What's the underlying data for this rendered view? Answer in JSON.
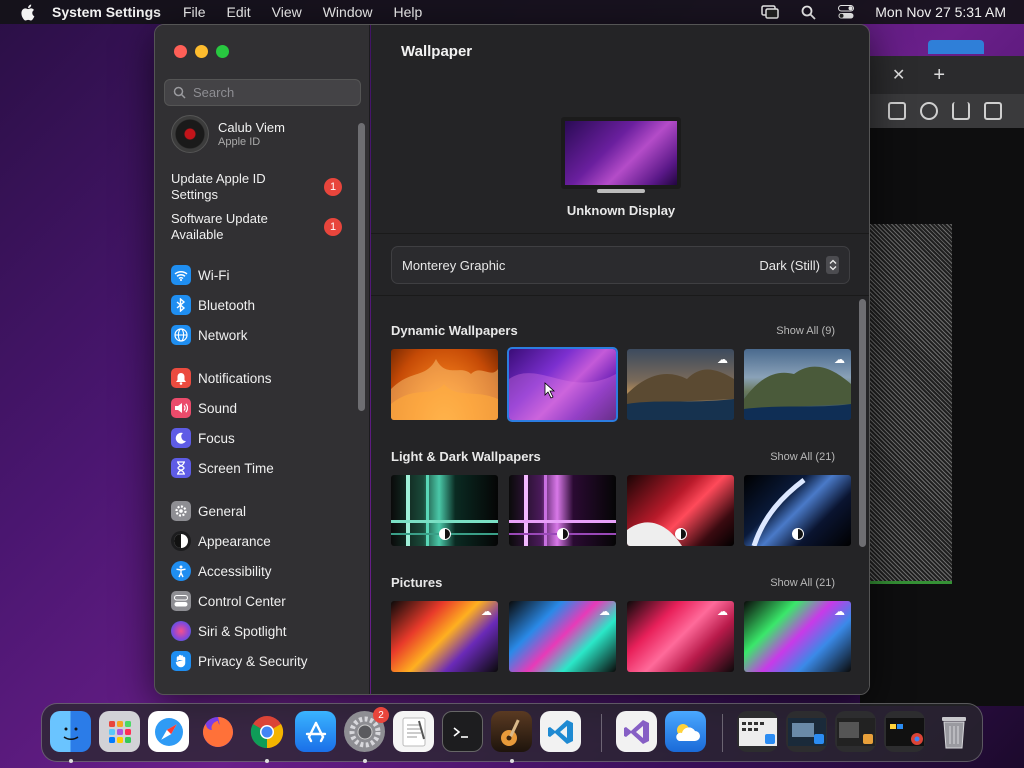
{
  "menubar": {
    "app_name": "System Settings",
    "items": [
      "File",
      "Edit",
      "View",
      "Window",
      "Help"
    ],
    "clock": "Mon Nov 27  5:31 AM"
  },
  "sidebar": {
    "search_placeholder": "Search",
    "profile": {
      "name": "Calub Viem",
      "subtitle": "Apple ID"
    },
    "alerts": [
      {
        "label_line1": "Update Apple ID",
        "label_line2": "Settings",
        "badge": "1"
      },
      {
        "label_line1": "Software Update",
        "label_line2": "Available",
        "badge": "1"
      }
    ],
    "items": [
      {
        "label": "Wi-Fi",
        "icon": "wifi-icon",
        "color": "#1f8ef1"
      },
      {
        "label": "Bluetooth",
        "icon": "bluetooth-icon",
        "color": "#1f8ef1"
      },
      {
        "label": "Network",
        "icon": "globe-icon",
        "color": "#1f8ef1"
      },
      {
        "label": "Notifications",
        "icon": "bell-icon",
        "color": "#eb4b3f"
      },
      {
        "label": "Sound",
        "icon": "speaker-icon",
        "color": "#eb4b6b"
      },
      {
        "label": "Focus",
        "icon": "moon-icon",
        "color": "#5e5ce6"
      },
      {
        "label": "Screen Time",
        "icon": "hourglass-icon",
        "color": "#5e5ce6"
      },
      {
        "label": "General",
        "icon": "gear-icon",
        "color": "#8e8e93"
      },
      {
        "label": "Appearance",
        "icon": "appearance-icon",
        "color": "#1c1c1e"
      },
      {
        "label": "Accessibility",
        "icon": "accessibility-icon",
        "color": "#1f8ef1"
      },
      {
        "label": "Control Center",
        "icon": "control-center-icon",
        "color": "#8e8e93"
      },
      {
        "label": "Siri & Spotlight",
        "icon": "siri-icon",
        "color": "#b04ac7"
      },
      {
        "label": "Privacy & Security",
        "icon": "hand-icon",
        "color": "#1f8ef1"
      }
    ]
  },
  "main": {
    "title": "Wallpaper",
    "display_name": "Unknown Display",
    "wallpaper_name": "Monterey Graphic",
    "wallpaper_mode": "Dark (Still)",
    "sections": [
      {
        "title": "Dynamic Wallpapers",
        "show_all": "Show All (9)"
      },
      {
        "title": "Light & Dark Wallpapers",
        "show_all": "Show All (21)"
      },
      {
        "title": "Pictures",
        "show_all": "Show All (21)"
      }
    ]
  },
  "browser": {
    "close_glyph": "✕",
    "new_tab_glyph": "+"
  },
  "dock": {
    "items": [
      {
        "name": "finder",
        "color": "#2b8cf2"
      },
      {
        "name": "launchpad",
        "color": "#c9c9cf"
      },
      {
        "name": "safari",
        "color": "#2f9bf5"
      },
      {
        "name": "firefox",
        "color": "#7b3fe4"
      },
      {
        "name": "chrome",
        "color": "#e9e9e9"
      },
      {
        "name": "app-store",
        "color": "#1e8ff3"
      },
      {
        "name": "system-settings",
        "color": "#8e8e93",
        "badge": "2"
      },
      {
        "name": "textedit",
        "color": "#f5f5f5"
      },
      {
        "name": "terminal",
        "color": "#1d1d1f"
      },
      {
        "name": "garageband",
        "color": "#3a2a1e"
      },
      {
        "name": "vscode",
        "color": "#f2f2f2"
      },
      {
        "name": "visual-studio",
        "color": "#f2f2f2"
      },
      {
        "name": "weather",
        "color": "#3a8fe8"
      },
      {
        "name": "minimized-window-1",
        "color": "#2d2d2f"
      },
      {
        "name": "minimized-window-2",
        "color": "#2d2d2f"
      },
      {
        "name": "minimized-window-3",
        "color": "#2d2d2f"
      },
      {
        "name": "minimized-window-4",
        "color": "#2d2d2f"
      },
      {
        "name": "trash",
        "color": "#8e8e93"
      }
    ]
  }
}
